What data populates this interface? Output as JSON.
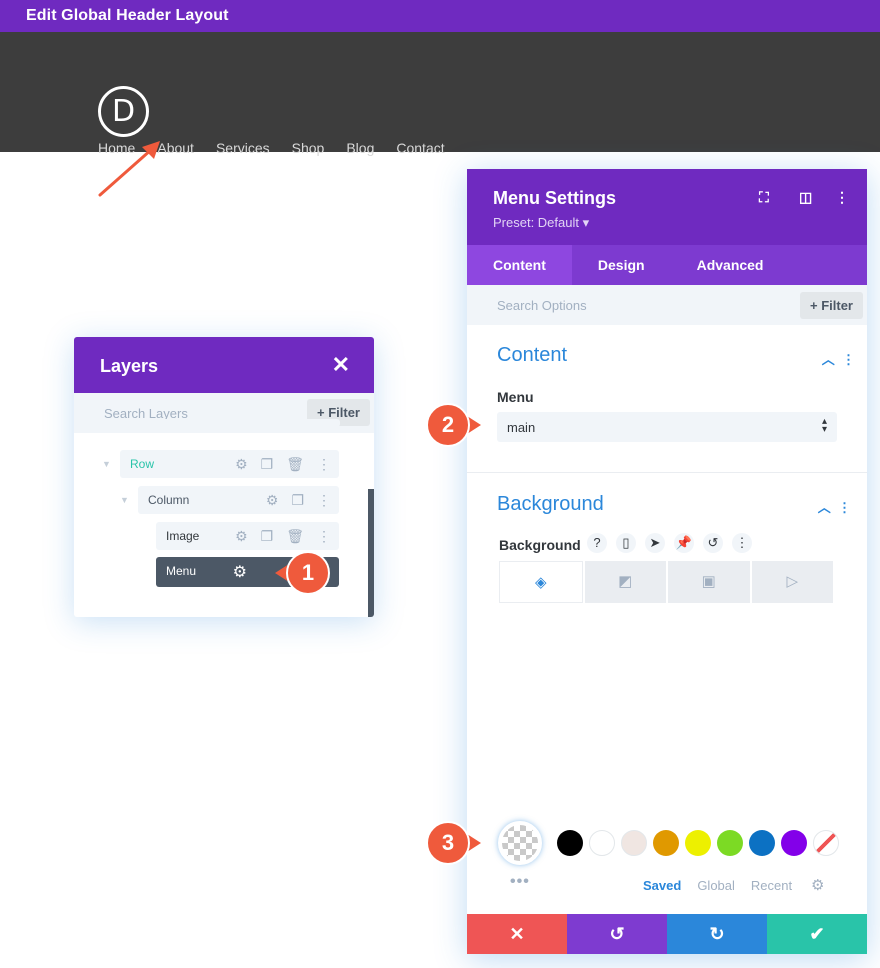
{
  "topbar": {
    "title": "Edit Global Header Layout"
  },
  "header": {
    "logo_letter": "D",
    "nav": [
      "Home",
      "About",
      "Services",
      "Shop",
      "Blog",
      "Contact"
    ]
  },
  "layers": {
    "title": "Layers",
    "close": "✕",
    "search_placeholder": "Search Layers",
    "filter_label": "+ Filter",
    "rows": [
      {
        "label": "Row"
      },
      {
        "label": "Column"
      },
      {
        "label": "Image"
      },
      {
        "label": "Menu"
      }
    ]
  },
  "settings": {
    "title": "Menu Settings",
    "preset": "Preset: Default ▾",
    "tabs": [
      "Content",
      "Design",
      "Advanced"
    ],
    "search_placeholder": "Search Options",
    "filter_label": "+ Filter",
    "content_section": "Content",
    "menu_label": "Menu",
    "menu_value": "main",
    "background_section": "Background",
    "background_label": "Background",
    "palette_tabs": [
      "Saved",
      "Global",
      "Recent"
    ],
    "swatch_colors": [
      "#000000",
      "#ffffff",
      "#f0e6e2",
      "#e09900",
      "#edf000",
      "#7cda24",
      "#0c71c3",
      "#8300e9"
    ]
  },
  "callouts": [
    "1",
    "2",
    "3"
  ],
  "colors": {
    "accent_purple": "#6f2ac0",
    "accent_blue": "#2b87da",
    "header_bg": "#3d3d3d",
    "callout_red": "#ef5a3c",
    "cancel": "#ef5555",
    "undo": "#7e3bd0",
    "redo": "#2b87da",
    "save": "#29c4a9"
  }
}
